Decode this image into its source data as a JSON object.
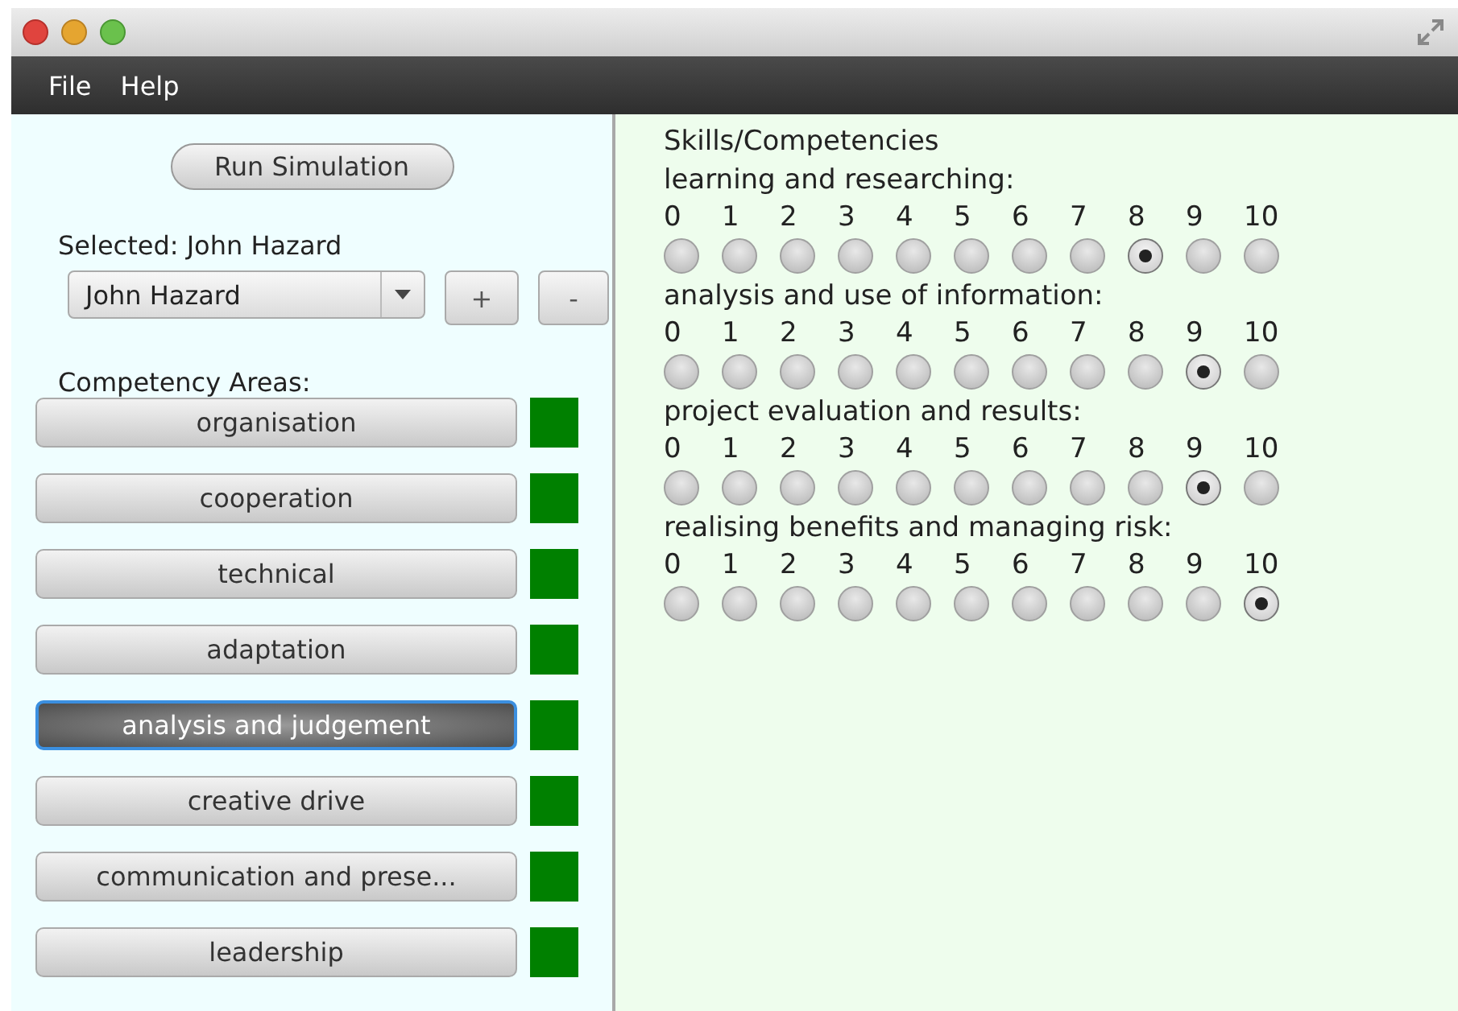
{
  "menu": [
    {
      "label": "File"
    },
    {
      "label": "Help"
    }
  ],
  "run_button": "Run Simulation",
  "selected_label": "Selected: John Hazard",
  "person_select": {
    "value": "John Hazard"
  },
  "add_button": "+",
  "remove_button": "-",
  "areas_heading": "Competency Areas:",
  "areas": [
    {
      "label": "organisation",
      "selected": false,
      "color": "#008000"
    },
    {
      "label": "cooperation",
      "selected": false,
      "color": "#008000"
    },
    {
      "label": "technical",
      "selected": false,
      "color": "#008000"
    },
    {
      "label": "adaptation",
      "selected": false,
      "color": "#008000"
    },
    {
      "label": "analysis and judgement",
      "selected": true,
      "color": "#008000"
    },
    {
      "label": "creative drive",
      "selected": false,
      "color": "#008000"
    },
    {
      "label": "communication and prese...",
      "selected": false,
      "color": "#008000"
    },
    {
      "label": "leadership",
      "selected": false,
      "color": "#008000"
    }
  ],
  "skills_heading": "Skills/Competencies",
  "skills": [
    {
      "label": "learning and researching:",
      "options": [
        {
          "label": "0",
          "selected": false
        },
        {
          "label": "1",
          "selected": false
        },
        {
          "label": "2",
          "selected": false
        },
        {
          "label": "3",
          "selected": false
        },
        {
          "label": "4",
          "selected": false
        },
        {
          "label": "5",
          "selected": false
        },
        {
          "label": "6",
          "selected": false
        },
        {
          "label": "7",
          "selected": false
        },
        {
          "label": "8",
          "selected": true
        },
        {
          "label": "9",
          "selected": false
        },
        {
          "label": "10",
          "selected": false
        }
      ]
    },
    {
      "label": "analysis and use of information:",
      "options": [
        {
          "label": "0",
          "selected": false
        },
        {
          "label": "1",
          "selected": false
        },
        {
          "label": "2",
          "selected": false
        },
        {
          "label": "3",
          "selected": false
        },
        {
          "label": "4",
          "selected": false
        },
        {
          "label": "5",
          "selected": false
        },
        {
          "label": "6",
          "selected": false
        },
        {
          "label": "7",
          "selected": false
        },
        {
          "label": "8",
          "selected": false
        },
        {
          "label": "9",
          "selected": true
        },
        {
          "label": "10",
          "selected": false
        }
      ]
    },
    {
      "label": "project evaluation and results:",
      "options": [
        {
          "label": "0",
          "selected": false
        },
        {
          "label": "1",
          "selected": false
        },
        {
          "label": "2",
          "selected": false
        },
        {
          "label": "3",
          "selected": false
        },
        {
          "label": "4",
          "selected": false
        },
        {
          "label": "5",
          "selected": false
        },
        {
          "label": "6",
          "selected": false
        },
        {
          "label": "7",
          "selected": false
        },
        {
          "label": "8",
          "selected": false
        },
        {
          "label": "9",
          "selected": true
        },
        {
          "label": "10",
          "selected": false
        }
      ]
    },
    {
      "label": "realising benefits and managing risk:",
      "options": [
        {
          "label": "0",
          "selected": false
        },
        {
          "label": "1",
          "selected": false
        },
        {
          "label": "2",
          "selected": false
        },
        {
          "label": "3",
          "selected": false
        },
        {
          "label": "4",
          "selected": false
        },
        {
          "label": "5",
          "selected": false
        },
        {
          "label": "6",
          "selected": false
        },
        {
          "label": "7",
          "selected": false
        },
        {
          "label": "8",
          "selected": false
        },
        {
          "label": "9",
          "selected": false
        },
        {
          "label": "10",
          "selected": true
        }
      ]
    }
  ]
}
